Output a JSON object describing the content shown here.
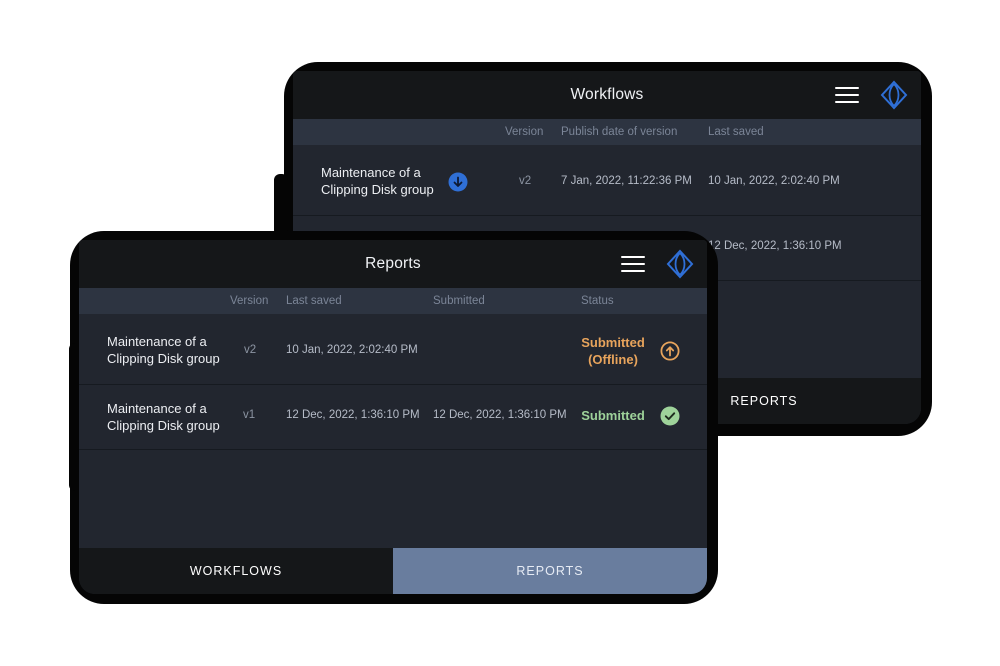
{
  "workflows_screen": {
    "title": "Workflows",
    "columns": [
      "Version",
      "Publish date of version",
      "Last saved"
    ],
    "rows": [
      {
        "name": "Maintenance of a Clipping Disk group",
        "version": "v2",
        "publish_date": "7 Jan, 2022, 11:22:36 PM",
        "last_saved": "10 Jan, 2022, 2:02:40 PM",
        "icon": "download-icon"
      },
      {
        "last_saved": "12 Dec, 2022, 1:36:10 PM"
      }
    ],
    "tab_reports": "REPORTS"
  },
  "reports_screen": {
    "title": "Reports",
    "columns": [
      "Version",
      "Last saved",
      "Submitted",
      "Status"
    ],
    "rows": [
      {
        "name": "Maintenance of a Clipping Disk group",
        "version": "v2",
        "last_saved": "10 Jan, 2022, 2:02:40 PM",
        "submitted": "",
        "status_line1": "Submitted",
        "status_line2": "(Offline)",
        "icon": "upload-icon"
      },
      {
        "name": "Maintenance of a Clipping Disk group",
        "version": "v1",
        "last_saved": "12 Dec, 2022, 1:36:10 PM",
        "submitted": "12 Dec, 2022, 1:36:10 PM",
        "status_line1": "Submitted",
        "icon": "check-circle-icon"
      }
    ],
    "tabs": [
      "WORKFLOWS",
      "REPORTS"
    ],
    "active_tab": "REPORTS"
  },
  "colors": {
    "accent_blue": "#2f6fd6",
    "status_offline": "#e8a45c",
    "status_submitted": "#9ed29a",
    "active_tab": "#697d9e"
  }
}
